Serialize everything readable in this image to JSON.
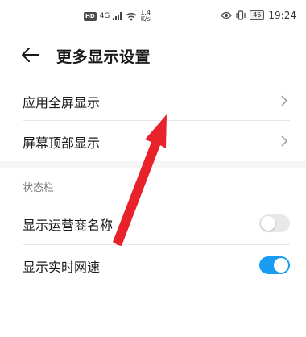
{
  "statusbar": {
    "hd": "HD",
    "network": "4G",
    "speed_value": "1.4",
    "speed_unit": "K/s",
    "battery": "46",
    "time": "19:24"
  },
  "header": {
    "title": "更多显示设置"
  },
  "rows": [
    {
      "label": "应用全屏显示"
    },
    {
      "label": "屏幕顶部显示"
    }
  ],
  "section_title": "状态栏",
  "toggles": [
    {
      "label": "显示运营商名称",
      "state": "off"
    },
    {
      "label": "显示实时网速",
      "state": "on"
    }
  ],
  "colors": {
    "accent": "#1a9cf2",
    "annotation_arrow": "#e8212a"
  }
}
